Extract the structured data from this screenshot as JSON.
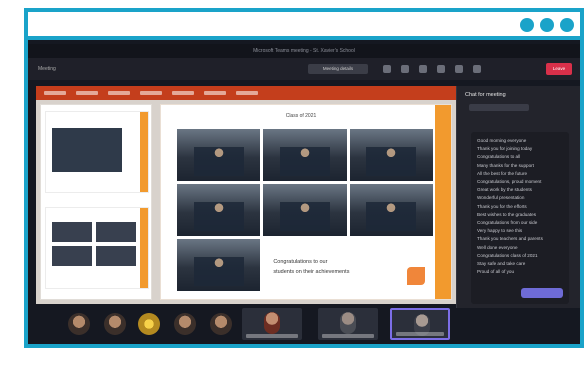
{
  "window": {
    "title": "Microsoft Teams meeting - St. Xavier's School",
    "meet_label": "Meeting",
    "meeting_tab": "Meeting details",
    "leave_label": "Leave"
  },
  "ribbon": {
    "tabs": [
      "File",
      "Home",
      "Insert",
      "Design",
      "Transitions",
      "Animations",
      "Slide Show",
      "Review",
      "View"
    ]
  },
  "slide": {
    "title": "Class of 2021",
    "caption_lines": [
      "Congratulations to our",
      "students on their achievements"
    ]
  },
  "panel": {
    "title": "Chat for meeting",
    "chat_lines": [
      "Good morning everyone",
      "Thank you for joining today",
      "Congratulations to all",
      "Many thanks for the support",
      "All the best for the future",
      "Congratulations, proud moment",
      "Great work by the students",
      "Wonderful presentation",
      "Thank you for the efforts",
      "Best wishes to the graduates",
      "Congratulations from our side",
      "Very happy to see this",
      "Thank you teachers and parents",
      "Well done everyone",
      "Congratulations class of 2021",
      "Stay safe and take care",
      "Proud of all of you"
    ]
  },
  "colors": {
    "frame_accent": "#1aa3c9",
    "ribbon": "#c43e1c",
    "slide_accent": "#f29a2e",
    "highlight_tile": "#7c6ee6"
  },
  "icons": {
    "menu": "three-dots-icon"
  }
}
